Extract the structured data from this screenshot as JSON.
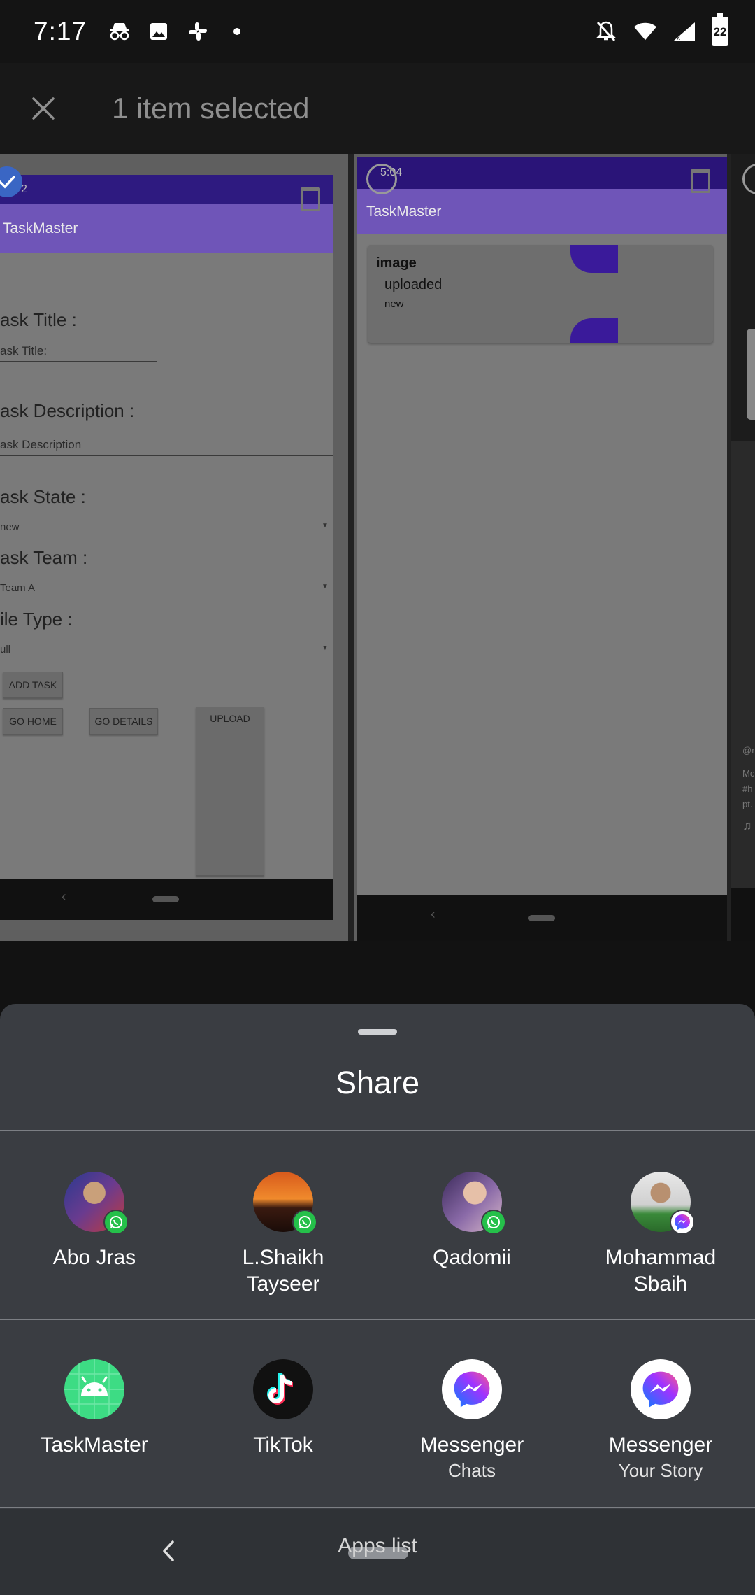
{
  "status_bar": {
    "time": "7:17",
    "battery_level": "22",
    "left_icons": [
      "incognito-icon",
      "image-icon",
      "slack-icon",
      "dot-icon"
    ],
    "right_icons": [
      "notifications-off-icon",
      "wifi-icon",
      "signal-icon",
      "battery-icon"
    ]
  },
  "selection_bar": {
    "title": "1 item selected",
    "close_icon": "close-icon"
  },
  "gallery": {
    "screenshot_1": {
      "clock": "2",
      "app_title": "TaskMaster",
      "labels": {
        "task_title": "ask Title :",
        "task_title_hint": "ask Title:",
        "task_description": "ask Description :",
        "task_description_hint": "ask Description",
        "task_state": "ask State :",
        "task_state_value": "new",
        "task_team": "ask Team :",
        "task_team_value": "Team A",
        "file_type": "ile Type :",
        "file_type_value": "ull"
      },
      "buttons": {
        "add_task": "ADD TASK",
        "go_home": "GO HOME",
        "go_details": "GO DETAILS",
        "upload": "UPLOAD"
      },
      "selected": true
    },
    "screenshot_2": {
      "clock": "5:04",
      "app_title": "TaskMaster",
      "card": {
        "title": "image",
        "status": "uploaded",
        "state": "new"
      },
      "selected": false
    },
    "screenshot_3": {
      "peek_lines": [
        "@r",
        "Mc",
        "#h",
        "pt.",
        "♫"
      ]
    }
  },
  "share_sheet": {
    "title": "Share",
    "direct_targets": [
      {
        "name": "Abo Jras",
        "badge": "whatsapp-icon"
      },
      {
        "name": "L.Shaikh Tayseer",
        "line1": "L.Shaikh",
        "line2": "Tayseer",
        "badge": "whatsapp-icon"
      },
      {
        "name": "Qadomii",
        "badge": "whatsapp-icon"
      },
      {
        "name": "Mohammad Sbaih",
        "line1": "Mohammad",
        "line2": "Sbaih",
        "badge": "messenger-icon"
      }
    ],
    "apps": [
      {
        "name": "TaskMaster",
        "icon": "android-icon",
        "color": "#3ddc84"
      },
      {
        "name": "TikTok",
        "icon": "tiktok-icon",
        "color": "#111111"
      },
      {
        "name": "Messenger",
        "sub": "Chats",
        "icon": "messenger-icon",
        "color": "#ffffff"
      },
      {
        "name": "Messenger",
        "sub": "Your Story",
        "icon": "messenger-icon",
        "color": "#ffffff"
      }
    ]
  },
  "nav_bar": {
    "hint": "Apps list",
    "back_icon": "back-chevron-icon"
  },
  "colors": {
    "accent_purple": "#6f55b8",
    "sheet_bg": "#3a3d42",
    "whatsapp": "#25c04a",
    "selected_check": "#3a66c4"
  }
}
